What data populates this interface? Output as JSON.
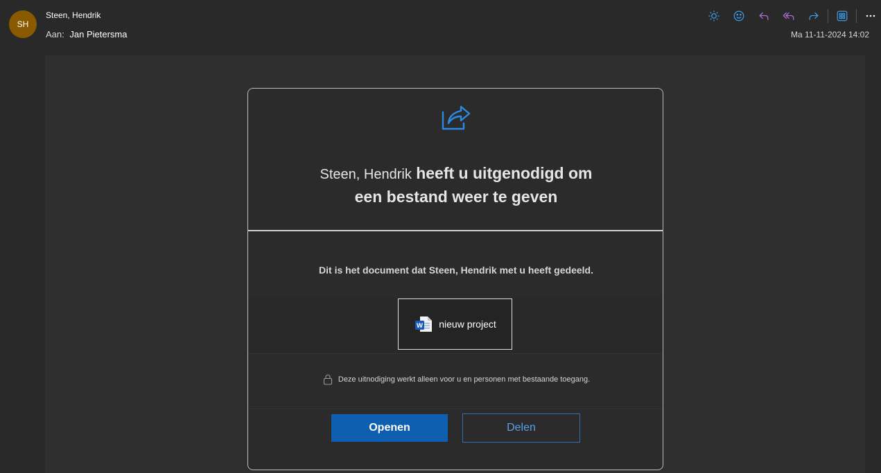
{
  "header": {
    "avatar_initials": "SH",
    "sender_name": "Steen, Hendrik",
    "to_label": "Aan:",
    "to_name": "Jan Pietersma",
    "datetime": "Ma 11-11-2024 14:02",
    "toolbar_icons": [
      "brightness-icon",
      "emoji-icon",
      "reply-icon",
      "reply-all-icon",
      "forward-icon",
      "apps-icon",
      "more-icon"
    ]
  },
  "card": {
    "headline_name": "Steen, Hendrik",
    "headline_line1_rest": " heeft u uitgenodigd om",
    "headline_line2": "een bestand weer te geven",
    "description": "Dit is het document dat Steen, Hendrik met u heeft gedeeld.",
    "file_name": "nieuw project",
    "notice": "Deze uitnodiging werkt alleen voor u en personen met bestaande toegang.",
    "open_label": "Openen",
    "share_label": "Delen"
  },
  "colors": {
    "accent": "#0f5fb0",
    "icon_blue": "#3a9be8",
    "icon_purple": "#b06fd6",
    "avatar_bg": "#8a5a00"
  }
}
